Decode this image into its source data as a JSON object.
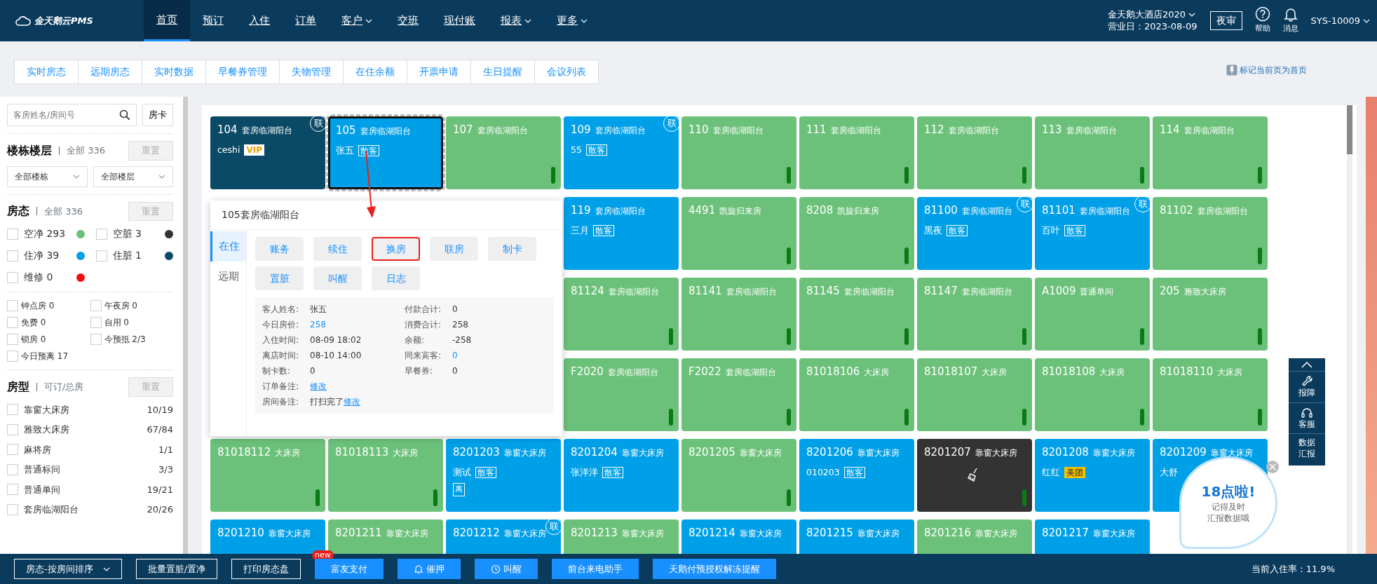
{
  "nav": {
    "logo": "金天鹅云PMS",
    "items": [
      {
        "label": "首页",
        "selected": true,
        "dropdown": false
      },
      {
        "label": "预订",
        "selected": false,
        "dropdown": false
      },
      {
        "label": "入住",
        "selected": false,
        "dropdown": false
      },
      {
        "label": "订单",
        "selected": false,
        "dropdown": false
      },
      {
        "label": "客户",
        "selected": false,
        "dropdown": true
      },
      {
        "label": "交班",
        "selected": false,
        "dropdown": false
      },
      {
        "label": "现付账",
        "selected": false,
        "dropdown": false
      },
      {
        "label": "报表",
        "selected": false,
        "dropdown": true
      },
      {
        "label": "更多",
        "selected": false,
        "dropdown": true
      }
    ],
    "hotel": "金天鹅大酒店2020",
    "business_day": "营业日：2023-08-09",
    "night_audit": "夜审",
    "help": "帮助",
    "messages": "消息",
    "user": "SYS-10009"
  },
  "tabs": [
    "实时房态",
    "远期房态",
    "实时数据",
    "早餐券管理",
    "失物管理",
    "在住余额",
    "开票申请",
    "生日提醒",
    "会议列表"
  ],
  "pin_home": "标记当前页为首页",
  "sidebar": {
    "search_placeholder": "客房姓名/房间号",
    "room_card": "房卡",
    "building": {
      "title": "楼栋楼层",
      "count": "全部 336",
      "reset": "重置",
      "selects": [
        "全部楼栋",
        "全部楼层"
      ]
    },
    "status": {
      "title": "房态",
      "count": "全部 336",
      "reset": "重置",
      "items": [
        {
          "label": "空净 293",
          "checked": false,
          "color": "#6cc17a"
        },
        {
          "label": "空脏 3",
          "checked": false,
          "color": "#333333"
        },
        {
          "label": "住净 39",
          "checked": false,
          "color": "#00a0e9"
        },
        {
          "label": "住脏 1",
          "checked": false,
          "color": "#0b4a66"
        },
        {
          "label": "维修 0",
          "checked": false,
          "color": "#f01010"
        }
      ]
    },
    "flags": [
      {
        "label": "钟点房 0",
        "checked": false
      },
      {
        "label": "午夜房 0",
        "checked": false
      },
      {
        "label": "免费 0",
        "checked": false
      },
      {
        "label": "自用 0",
        "checked": false
      },
      {
        "label": "锁房 0",
        "checked": false
      },
      {
        "label": "今预抵 2/3",
        "checked": false
      },
      {
        "label": "今日预离 17",
        "checked": false
      }
    ],
    "room_types": {
      "title": "房型",
      "count": "可订/总房",
      "reset": "重置",
      "items": [
        {
          "label": "靠窗大床房",
          "count": "10/19",
          "checked": false
        },
        {
          "label": "雅致大床房",
          "count": "67/84",
          "checked": false
        },
        {
          "label": "麻将房",
          "count": "1/1",
          "checked": false
        },
        {
          "label": "普通标间",
          "count": "3/3",
          "checked": false
        },
        {
          "label": "普通单间",
          "count": "19/21",
          "checked": false
        },
        {
          "label": "套房临湖阳台",
          "count": "20/26",
          "checked": false
        }
      ]
    }
  },
  "rooms": [
    [
      {
        "number": "104",
        "type": "套房临湖阳台",
        "kind": "occupied",
        "color": "#0b4a66",
        "guest": "ceshi",
        "source": {
          "text": "VIP",
          "kind": "vip"
        },
        "link": "联",
        "selected": false
      },
      {
        "number": "105",
        "type": "套房临湖阳台",
        "kind": "occupied",
        "color": "#00a0e9",
        "guest": "张五",
        "source": {
          "text": "散客",
          "kind": "plain"
        },
        "selected": true
      },
      {
        "number": "107",
        "type": "套房临湖阳台",
        "kind": "vacant",
        "color": "#6cc17a",
        "selected": false
      },
      {
        "number": "109",
        "type": "套房临湖阳台",
        "kind": "occupied",
        "color": "#00a0e9",
        "guest": "55",
        "source": {
          "text": "散客",
          "kind": "plain"
        },
        "link": "联",
        "selected": false
      },
      {
        "number": "110",
        "type": "套房临湖阳台",
        "kind": "vacant",
        "color": "#6cc17a",
        "selected": false
      },
      {
        "number": "111",
        "type": "套房临湖阳台",
        "kind": "vacant",
        "color": "#6cc17a",
        "selected": false
      },
      {
        "number": "112",
        "type": "套房临湖阳台",
        "kind": "vacant",
        "color": "#6cc17a",
        "selected": false
      },
      {
        "number": "113",
        "type": "套房临湖阳台",
        "kind": "vacant",
        "color": "#6cc17a",
        "selected": false
      },
      {
        "number": "114",
        "type": "套房临湖阳台",
        "kind": "vacant",
        "color": "#6cc17a",
        "selected": false
      }
    ],
    [
      {
        "number": "119",
        "type": "套房临湖阳台",
        "kind": "occupied",
        "color": "#00a0e9",
        "guest": "三月",
        "source": {
          "text": "散客",
          "kind": "plain"
        },
        "selected": false
      },
      {
        "number": "4491",
        "type": "凯旋归来房",
        "kind": "vacant",
        "color": "#6cc17a",
        "selected": false
      },
      {
        "number": "8208",
        "type": "凯旋归来房",
        "kind": "vacant",
        "color": "#6cc17a",
        "selected": false
      },
      {
        "number": "81100",
        "type": "套房临湖阳台",
        "kind": "occupied",
        "color": "#00a0e9",
        "guest": "黑夜",
        "source": {
          "text": "散客",
          "kind": "plain"
        },
        "link": "联",
        "selected": false
      },
      {
        "number": "81101",
        "type": "套房临湖阳台",
        "kind": "occupied",
        "color": "#00a0e9",
        "guest": "百叶",
        "source": {
          "text": "散客",
          "kind": "plain"
        },
        "link": "联",
        "selected": false
      },
      {
        "number": "81102",
        "type": "套房临湖阳台",
        "kind": "vacant",
        "color": "#6cc17a",
        "selected": false
      }
    ],
    [
      {
        "number": "81124",
        "type": "套房临湖阳台",
        "kind": "vacant",
        "color": "#6cc17a",
        "selected": false
      },
      {
        "number": "81141",
        "type": "套房临湖阳台",
        "kind": "vacant",
        "color": "#6cc17a",
        "selected": false
      },
      {
        "number": "81145",
        "type": "套房临湖阳台",
        "kind": "vacant",
        "color": "#6cc17a",
        "selected": false
      },
      {
        "number": "81147",
        "type": "套房临湖阳台",
        "kind": "vacant",
        "color": "#6cc17a",
        "selected": false
      },
      {
        "number": "A1009",
        "type": "普通单间",
        "kind": "vacant",
        "color": "#6cc17a",
        "selected": false
      },
      {
        "number": "205",
        "type": "雅致大床房",
        "kind": "vacant",
        "color": "#6cc17a",
        "selected": false
      }
    ],
    [
      {
        "number": "F2020",
        "type": "套房临湖阳台",
        "kind": "vacant",
        "color": "#6cc17a",
        "selected": false
      },
      {
        "number": "F2022",
        "type": "套房临湖阳台",
        "kind": "vacant",
        "color": "#6cc17a",
        "selected": false
      },
      {
        "number": "81018106",
        "type": "大床房",
        "kind": "vacant",
        "color": "#6cc17a",
        "selected": false
      },
      {
        "number": "81018107",
        "type": "大床房",
        "kind": "vacant",
        "color": "#6cc17a",
        "selected": false
      },
      {
        "number": "81018108",
        "type": "大床房",
        "kind": "vacant",
        "color": "#6cc17a",
        "selected": false
      },
      {
        "number": "81018110",
        "type": "大床房",
        "kind": "vacant",
        "color": "#6cc17a",
        "selected": false
      }
    ],
    [
      {
        "number": "81018112",
        "type": "大床房",
        "kind": "vacant",
        "color": "#6cc17a",
        "selected": false
      },
      {
        "number": "81018113",
        "type": "大床房",
        "kind": "vacant",
        "color": "#6cc17a",
        "selected": false
      },
      {
        "number": "8201203",
        "type": "靠窗大床房",
        "kind": "occupied",
        "color": "#00a0e9",
        "guest": "测试",
        "source": {
          "text": "散客",
          "kind": "plain"
        },
        "tag": "离",
        "selected": false
      },
      {
        "number": "8201204",
        "type": "靠窗大床房",
        "kind": "occupied",
        "color": "#00a0e9",
        "guest": "张洋洋",
        "source": {
          "text": "散客",
          "kind": "plain"
        },
        "selected": false
      },
      {
        "number": "8201205",
        "type": "靠窗大床房",
        "kind": "vacant",
        "color": "#6cc17a",
        "selected": false
      },
      {
        "number": "8201206",
        "type": "靠窗大床房",
        "kind": "occupied",
        "color": "#00a0e9",
        "guest": "010203",
        "source": {
          "text": "散客",
          "kind": "plain"
        },
        "selected": false
      },
      {
        "number": "8201207",
        "type": "靠窗大床房",
        "kind": "dirty",
        "color": "#333333",
        "selected": false
      },
      {
        "number": "8201208",
        "type": "靠窗大床房",
        "kind": "occupied",
        "color": "#00a0e9",
        "guest": "红红",
        "source": {
          "text": "美团",
          "kind": "meituan"
        },
        "selected": false
      },
      {
        "number": "8201209",
        "type": "靠窗大床房",
        "kind": "occupied",
        "color": "#00a0e9",
        "guest": "大舒",
        "selected": false
      }
    ],
    [
      {
        "number": "8201210",
        "type": "靠窗大床房",
        "kind": "occupied",
        "color": "#00a0e9",
        "selected": false
      },
      {
        "number": "8201211",
        "type": "靠窗大床房",
        "kind": "vacant",
        "color": "#6cc17a",
        "selected": false
      },
      {
        "number": "8201212",
        "type": "靠窗大床房",
        "kind": "occupied",
        "color": "#00a0e9",
        "link": "联",
        "selected": false
      },
      {
        "number": "8201213",
        "type": "靠窗大床房",
        "kind": "vacant",
        "color": "#6cc17a",
        "selected": false
      },
      {
        "number": "8201214",
        "type": "靠窗大床房",
        "kind": "occupied",
        "color": "#00a0e9",
        "selected": false
      },
      {
        "number": "8201215",
        "type": "靠窗大床房",
        "kind": "occupied",
        "color": "#00a0e9",
        "selected": false
      },
      {
        "number": "8201216",
        "type": "靠窗大床房",
        "kind": "vacant",
        "color": "#6cc17a",
        "selected": false
      },
      {
        "number": "8201217",
        "type": "靠窗大床房",
        "kind": "occupied",
        "color": "#00a0e9",
        "selected": false
      }
    ]
  ],
  "popup": {
    "title": "105套房临湖阳台",
    "tabs": [
      {
        "label": "在住",
        "selected": true
      },
      {
        "label": "远期",
        "selected": false
      }
    ],
    "actions": [
      {
        "label": "账务",
        "highlighted": false
      },
      {
        "label": "续住",
        "highlighted": false
      },
      {
        "label": "换房",
        "highlighted": true
      },
      {
        "label": "联房",
        "highlighted": false
      },
      {
        "label": "制卡",
        "highlighted": false
      },
      {
        "label": "置脏",
        "highlighted": false
      },
      {
        "label": "叫醒",
        "highlighted": false
      },
      {
        "label": "日志",
        "highlighted": false
      }
    ],
    "info": [
      {
        "label": "客人姓名:",
        "value": "张五",
        "kind": "plain"
      },
      {
        "label": "付款合计:",
        "value": "0",
        "kind": "plain"
      },
      {
        "label": "今日房价:",
        "value": "258",
        "kind": "link"
      },
      {
        "label": "消费合计:",
        "value": "258",
        "kind": "plain"
      },
      {
        "label": "入住时间:",
        "value": "08-09 18:02",
        "kind": "plain"
      },
      {
        "label": "余额:",
        "value": "-258",
        "kind": "plain"
      },
      {
        "label": "离店时间:",
        "value": "08-10 14:00",
        "kind": "plain"
      },
      {
        "label": "同来宾客:",
        "value": "0",
        "kind": "link"
      },
      {
        "label": "制卡数:",
        "value": "0",
        "kind": "plain"
      },
      {
        "label": "早餐券:",
        "value": "0",
        "kind": "plain"
      },
      {
        "label": "订单备注:",
        "link": "修改"
      },
      {
        "label": "房间备注:",
        "value": "打扫完了",
        "kind": "plain",
        "link": "修改"
      }
    ]
  },
  "float_toolbar": [
    {
      "label": "报障",
      "kind": "wrench"
    },
    {
      "label": "客服",
      "kind": "headset"
    },
    {
      "label": "数据汇报",
      "kind": "none"
    }
  ],
  "ad": {
    "title": "18点啦!",
    "lines": [
      "记得及时",
      "汇报数据哦"
    ]
  },
  "bottom_bar": {
    "sort": "房态-按房间排序",
    "buttons": [
      {
        "label": "批量置脏/置净",
        "kind": "outline"
      },
      {
        "label": "打印房态盘",
        "kind": "outline"
      },
      {
        "label": "富友支付",
        "kind": "primary",
        "badge": "new"
      },
      {
        "label": "催押",
        "kind": "alert"
      },
      {
        "label": "叫醒",
        "kind": "timer"
      },
      {
        "label": "前台来电助手",
        "kind": "primary"
      },
      {
        "label": "天鹅付预授权解冻提醒",
        "kind": "primary"
      }
    ],
    "occupancy": "当前入住率：11.9%"
  }
}
